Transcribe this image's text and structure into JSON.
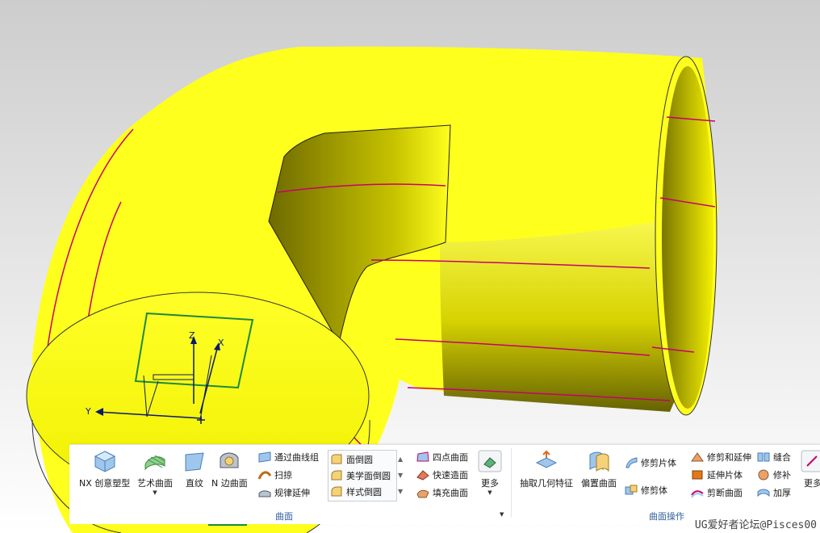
{
  "viewport": {
    "axis_labels": {
      "z": "Z",
      "x": "X",
      "y": "Y"
    },
    "colors": {
      "surface": "#ffff1e",
      "shade": "#6e6a00",
      "edge": "#c8006e",
      "background": "#ffffff"
    }
  },
  "ribbon": {
    "groups": [
      {
        "title": "曲面"
      },
      {
        "title": "曲面操作"
      }
    ],
    "surface": {
      "large_buttons": [
        "NX 创意塑型",
        "艺术曲面",
        "直纹",
        "N 边曲面"
      ],
      "small_buttons": [
        "通过曲线组",
        "扫掠",
        "规律延伸"
      ],
      "fillet_combo": [
        "面倒圆",
        "美学面倒圆",
        "样式倒圆"
      ],
      "small_buttons_2": [
        "四点曲面",
        "快速造面",
        "填充曲面"
      ],
      "more_label": "更多"
    },
    "surface_ops": {
      "large_buttons": [
        "抽取几何特征",
        "偏置曲面"
      ],
      "col1": [
        "修剪片体",
        "修剪体"
      ],
      "col2": [
        "修剪和延伸",
        "延伸片体",
        "剪断曲面"
      ],
      "col3": [
        "缝合",
        "修补",
        "加厚"
      ],
      "more_label": "更多"
    }
  },
  "watermark": "UG爱好者论坛@Pisces00",
  "icons": [
    "nx-realize-shape-icon",
    "studio-surface-icon",
    "ruled-icon",
    "n-sided-surface-icon",
    "through-curve-mesh-icon",
    "swept-icon",
    "law-extension-icon",
    "face-blend-icon",
    "aesthetic-face-blend-icon",
    "styled-blend-icon",
    "four-point-surface-icon",
    "rapid-surfacing-icon",
    "fill-surface-icon",
    "extract-geometry-icon",
    "offset-surface-icon",
    "trim-sheet-icon",
    "trim-body-icon",
    "trim-extend-icon",
    "extend-sheet-icon",
    "divide-face-icon",
    "sew-icon",
    "patch-icon",
    "thicken-icon"
  ]
}
